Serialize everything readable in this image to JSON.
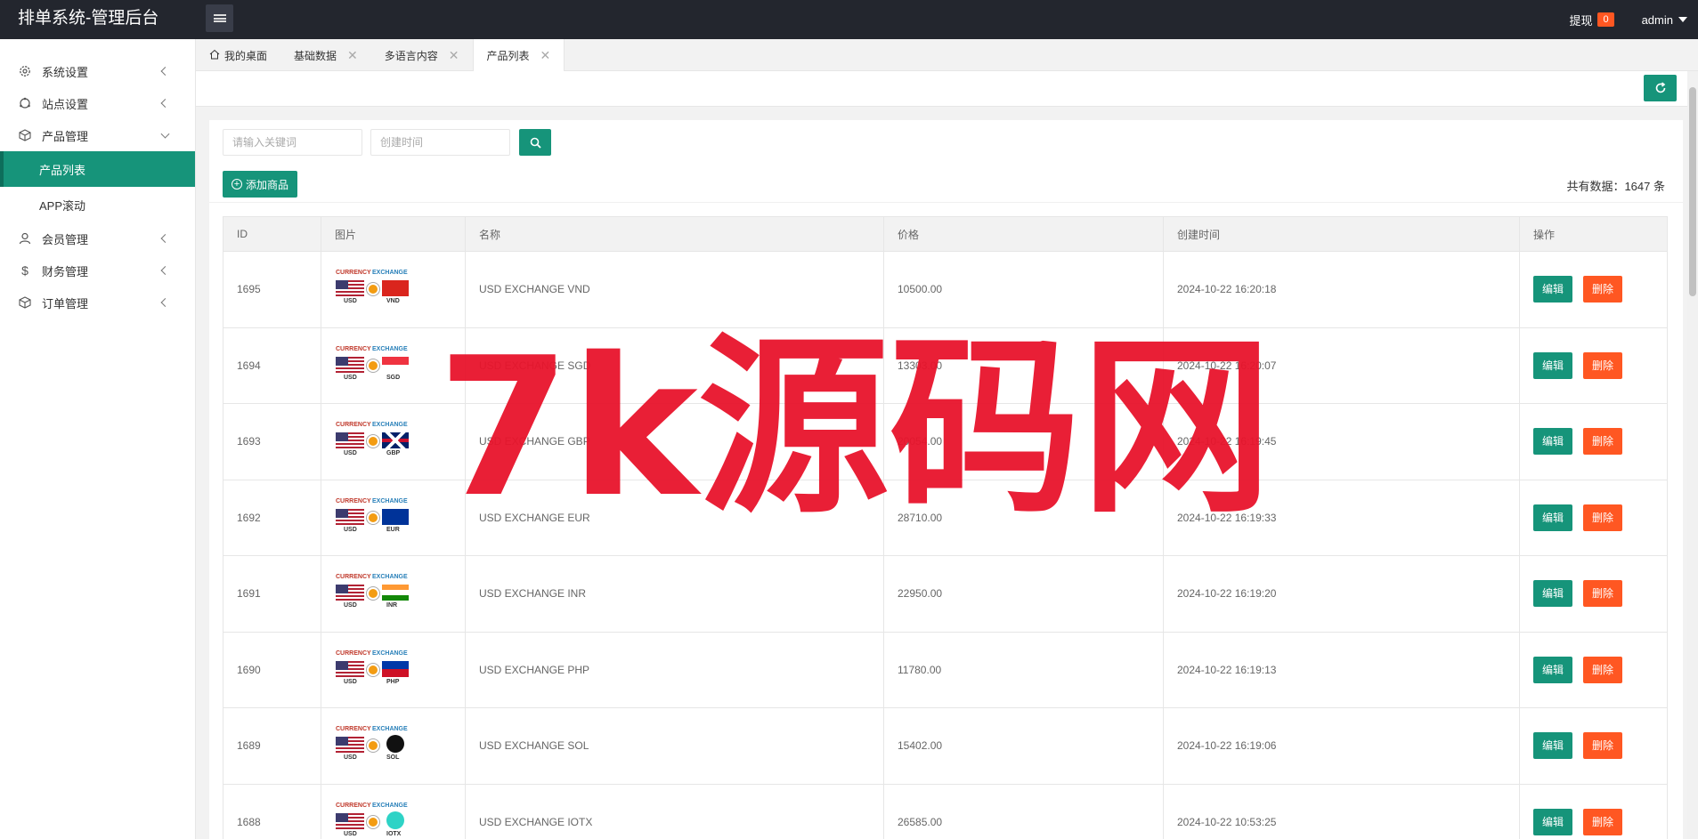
{
  "app": {
    "title": "排单系统-管理后台"
  },
  "header": {
    "withdraw_label": "提现",
    "withdraw_badge": "0",
    "user": "admin"
  },
  "sidebar": {
    "items": [
      {
        "label": "系统设置",
        "icon": "gear-icon"
      },
      {
        "label": "站点设置",
        "icon": "site-icon"
      },
      {
        "label": "产品管理",
        "icon": "cube-icon"
      },
      {
        "label": "会员管理",
        "icon": "user-icon"
      },
      {
        "label": "财务管理",
        "icon": "dollar-icon"
      },
      {
        "label": "订单管理",
        "icon": "cube-icon"
      }
    ],
    "sub_items": [
      {
        "label": "产品列表",
        "active": true
      },
      {
        "label": "APP滚动",
        "active": false
      }
    ]
  },
  "tabs": [
    {
      "label": "我的桌面",
      "icon": "home-icon"
    },
    {
      "label": "基础数据"
    },
    {
      "label": "多语言内容"
    },
    {
      "label": "产品列表",
      "active": true
    }
  ],
  "search": {
    "keyword_placeholder": "请输入关键词",
    "time_placeholder": "创建时间"
  },
  "actions": {
    "add_label": "添加商品",
    "total_text": "共有数据：1647 条",
    "edit_label": "编辑",
    "delete_label": "删除"
  },
  "table": {
    "columns": [
      "ID",
      "图片",
      "名称",
      "价格",
      "创建时间",
      "操作"
    ],
    "rows": [
      {
        "id": "1695",
        "thumb_pair": [
          "USD",
          "VND"
        ],
        "name": "USD EXCHANGE VND",
        "price": "10500.00",
        "created": "2024-10-22 16:20:18"
      },
      {
        "id": "1694",
        "thumb_pair": [
          "USD",
          "SGD"
        ],
        "name": "USD EXCHANGE SGD",
        "price": "13303.00",
        "created": "2024-10-22 16:20:07"
      },
      {
        "id": "1693",
        "thumb_pair": [
          "USD",
          "GBP"
        ],
        "name": "USD EXCHANGE GBP",
        "price": "20054.00",
        "created": "2024-10-22 16:19:45"
      },
      {
        "id": "1692",
        "thumb_pair": [
          "USD",
          "EUR"
        ],
        "name": "USD EXCHANGE EUR",
        "price": "28710.00",
        "created": "2024-10-22 16:19:33"
      },
      {
        "id": "1691",
        "thumb_pair": [
          "USD",
          "INR"
        ],
        "name": "USD EXCHANGE INR",
        "price": "22950.00",
        "created": "2024-10-22 16:19:20"
      },
      {
        "id": "1690",
        "thumb_pair": [
          "USD",
          "PHP"
        ],
        "name": "USD EXCHANGE PHP",
        "price": "11780.00",
        "created": "2024-10-22 16:19:13"
      },
      {
        "id": "1689",
        "thumb_pair": [
          "USD",
          "SOL"
        ],
        "name": "USD EXCHANGE SOL",
        "price": "15402.00",
        "created": "2024-10-22 16:19:06"
      },
      {
        "id": "1688",
        "thumb_pair": [
          "USD",
          "IOTX"
        ],
        "name": "USD EXCHANGE IOTX",
        "price": "26585.00",
        "created": "2024-10-22 10:53:25"
      }
    ]
  },
  "thumbnail": {
    "word1": "CURRENCY",
    "word2": "EXCHANGE"
  },
  "watermark": {
    "text": "7k源码网"
  },
  "colors": {
    "accent": "#16947a",
    "danger": "#ff5722",
    "header_bg": "#23262e",
    "watermark": "#e8142c"
  }
}
